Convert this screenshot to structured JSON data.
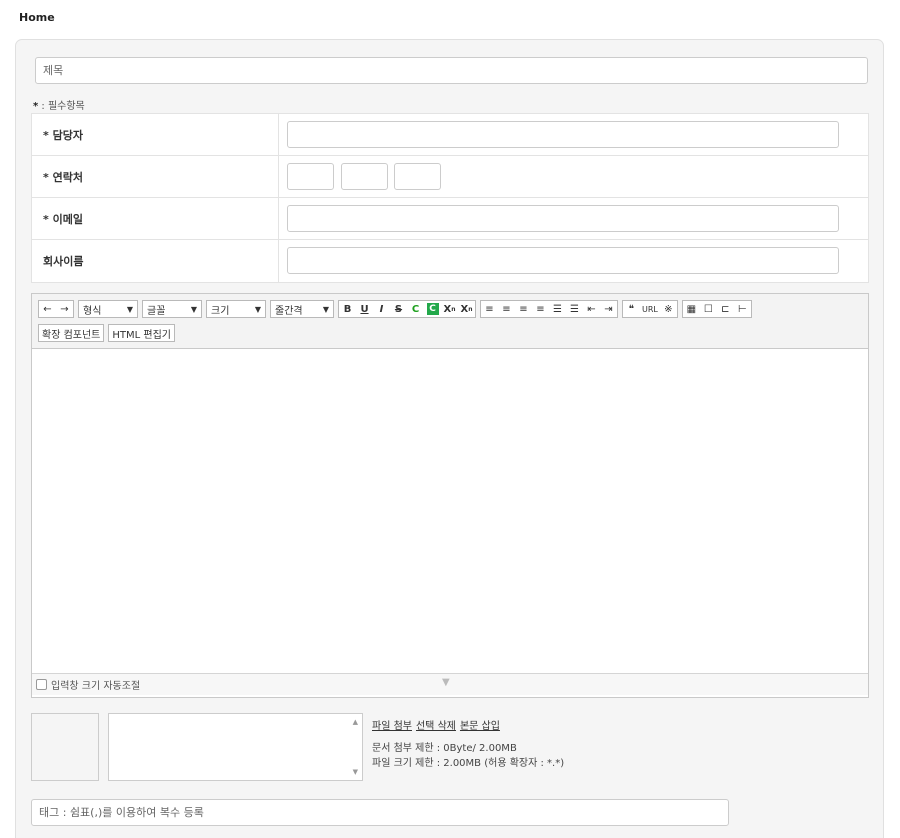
{
  "breadcrumb": "Home",
  "title_placeholder": "제목",
  "required_note": {
    "star": "*",
    "text": " : 필수항목"
  },
  "fields": [
    {
      "label": "* 담당자"
    },
    {
      "label": "* 연락처"
    },
    {
      "label": "* 이메일"
    },
    {
      "label": "회사이름"
    }
  ],
  "editor": {
    "undo": "←",
    "redo": "→",
    "format_select": "형식",
    "font_select": "글꼴",
    "size_select": "크기",
    "lineheight_select": "줄간격",
    "dropdown_arrow": "▼",
    "bold": "B",
    "underline": "U",
    "italic": "I",
    "strike": "S",
    "fontcolor": "C",
    "bgcolor": "C",
    "superscript": "X",
    "subscript": "X",
    "sup_mark": "n",
    "sub_mark": "n",
    "align_left": "≡",
    "align_center": "≡",
    "align_right": "≡",
    "align_justify": "≡",
    "ordered_list": "☰",
    "unordered_list": "☰",
    "outdent": "⇤",
    "indent": "⇥",
    "quote": "❝",
    "url": "URL",
    "special_char": "※",
    "table": "▦",
    "box": "☐",
    "col": "⊏",
    "row": "⊢",
    "extension_button": "확장 컴포넌트",
    "html_button": "HTML 편집기",
    "autosize_label": "입력창 크기 자동조절",
    "resize_arrow": "▼"
  },
  "attachments": {
    "links": [
      "파일 첨부",
      "선택 삭제",
      "본문 삽입"
    ],
    "doc_limit": "문서 첨부 제한 : 0Byte/ 2.00MB",
    "file_limit": "파일 크기 제한 : 2.00MB (허용 확장자 : *.*)",
    "scroll_up": "▲",
    "scroll_down": "▼"
  },
  "tag_placeholder": "태그 : 쉼표(,)를 이용하여 복수 등록"
}
